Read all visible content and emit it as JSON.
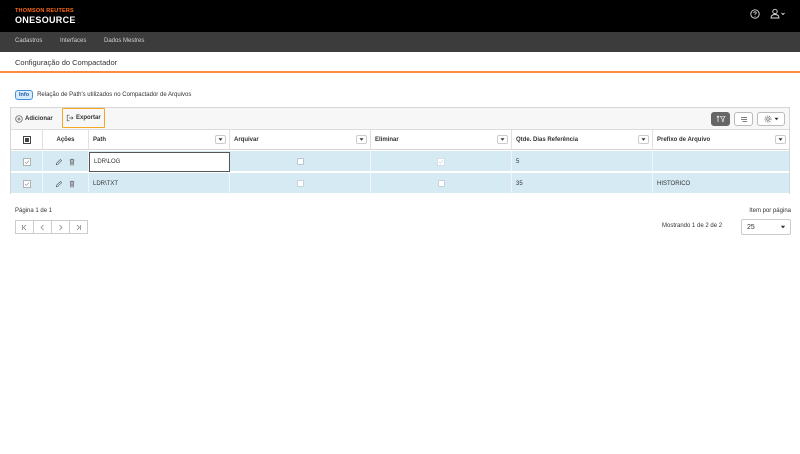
{
  "brand": {
    "top": "THOMSON REUTERS",
    "name": "ONESOURCE"
  },
  "menu": [
    "Cadastros",
    "Interfaces",
    "Dados Mestres"
  ],
  "page": {
    "title": "Configuração do Compactador"
  },
  "info": {
    "badge": "Info",
    "text": "Relação de Path's utilizados no Compactador de Arquivos"
  },
  "toolbar": {
    "add_label": "Adicionar",
    "export_label": "Exportar"
  },
  "columns": [
    "Ações",
    "Path",
    "Arquivar",
    "Eliminar",
    "Qtde. Dias Referência",
    "Prefixo de Arquivo"
  ],
  "rows": [
    {
      "path": "LDR\\LOG",
      "arquivar": false,
      "eliminar": false,
      "dias": "5",
      "prefixo": ""
    },
    {
      "path": "LDR\\TXT",
      "arquivar": false,
      "eliminar": false,
      "dias": "35",
      "prefixo": "HISTORICO"
    }
  ],
  "pager": {
    "page_label": "Página 1 de 1",
    "items_per_page_label": "Item por página",
    "showing": "Mostrando 1 de 2 de 2",
    "page_size": "25",
    "first_icon": "first-page-icon",
    "prev_icon": "prev-page-icon",
    "next_icon": "next-page-icon",
    "last_icon": "last-page-icon"
  },
  "colors": {
    "accent": "#ff8a3d",
    "row_bg": "#d6eaf4",
    "topbar": "#000000",
    "menubar": "#3c3c3c"
  }
}
